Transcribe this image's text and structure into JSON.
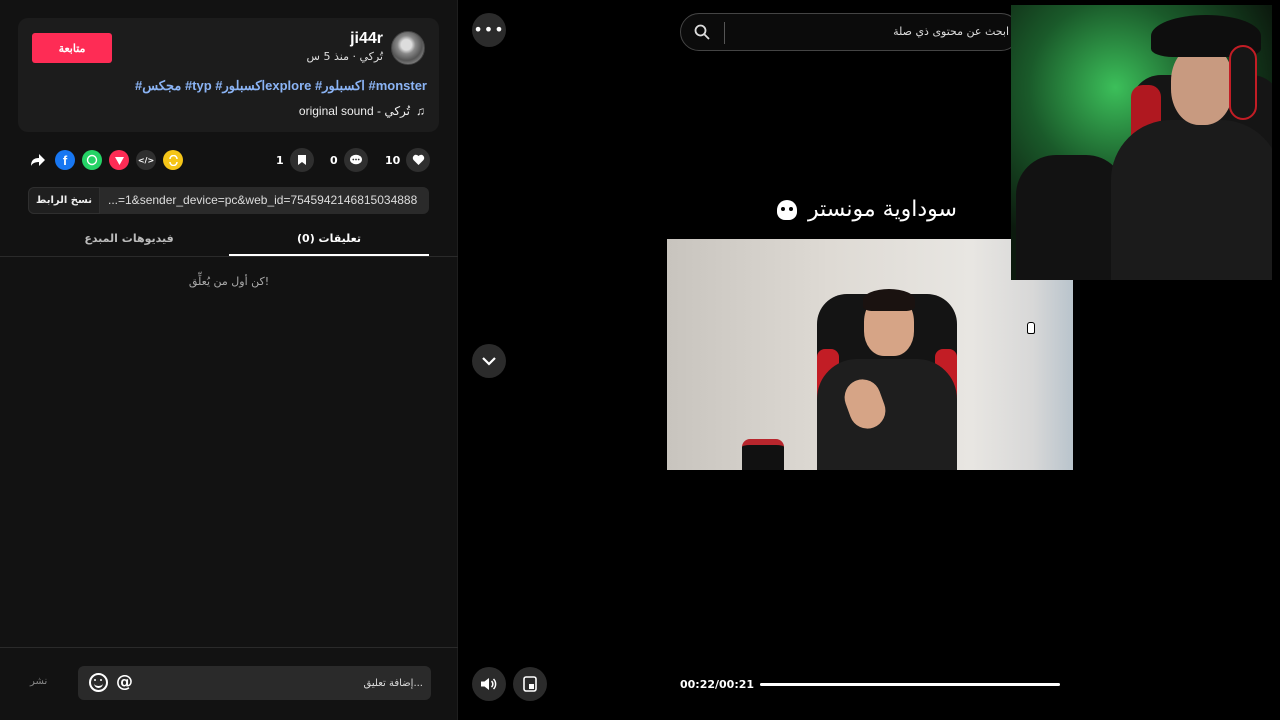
{
  "post": {
    "username": "ji44r",
    "meta": "تُركي · منذ 5 س",
    "follow_label": "متابعة",
    "hashtags": "#مجكس #typ #اكسبلورexplore #اكسبلور #monster",
    "sound": "original sound - تُركي",
    "music_icon": "♫"
  },
  "stats": {
    "likes": "10",
    "comments": "0",
    "saves": "1"
  },
  "share_icons": [
    "repost-icon",
    "embed-icon",
    "send-icon",
    "whatsapp-icon",
    "facebook-icon",
    "share-arrow-icon"
  ],
  "link": {
    "copy_label": "نسخ الرابط",
    "url_text": "...=1&sender_device=pc&web_id=7545942146815034888"
  },
  "tabs": {
    "comments": "تعليقات (0)",
    "creator_videos": "فيديوهات المبدع"
  },
  "empty_comments": "كن أول من يُعلِّق!",
  "comment_box": {
    "placeholder": "إضافة تعليق...",
    "post_label": "نشر",
    "at_symbol": "@"
  },
  "search": {
    "text": "ابحث عن محتوى ذي صلة"
  },
  "video": {
    "caption": "سوداوية مونستر",
    "time": "00:22/00:21",
    "progress": 1.0
  },
  "colors": {
    "accent": "#fe2c55",
    "hashtag": "#8bb4f5"
  }
}
